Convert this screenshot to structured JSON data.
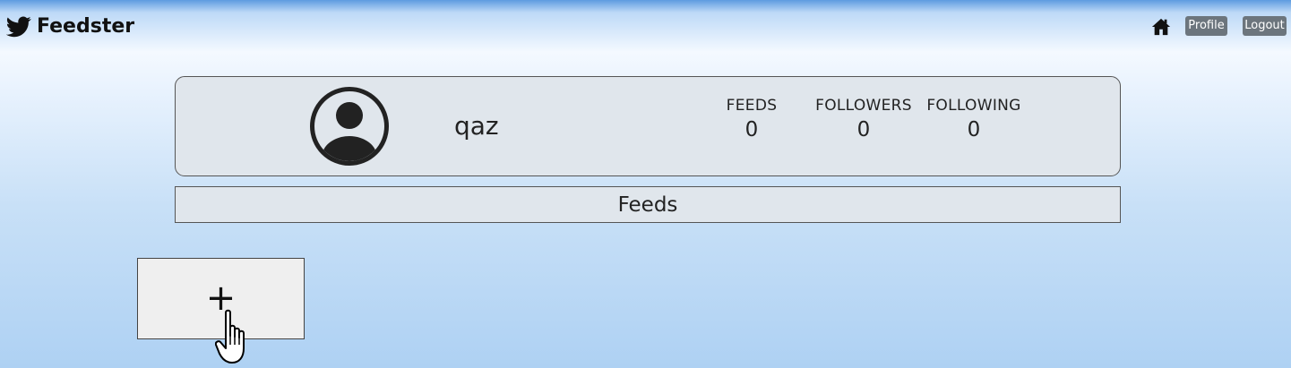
{
  "app": {
    "brand": "Feedster",
    "brand_icon": "twitter-bird-icon"
  },
  "nav": {
    "home_icon": "home-icon",
    "profile_label": "Profile",
    "logout_label": "Logout",
    "button_color": "#6c757d"
  },
  "profile": {
    "avatar_icon": "user-circle-icon",
    "username": "qaz",
    "stats": [
      {
        "label": "FEEDS",
        "value": "0"
      },
      {
        "label": "FOLLOWERS",
        "value": "0"
      },
      {
        "label": "FOLLOWING",
        "value": "0"
      }
    ]
  },
  "feeds": {
    "title": "Feeds"
  },
  "add_card": {
    "symbol": "+",
    "icon": "plus-icon"
  },
  "colors": {
    "card_background": "#e0e6ec",
    "add_card_background": "#efefef"
  }
}
